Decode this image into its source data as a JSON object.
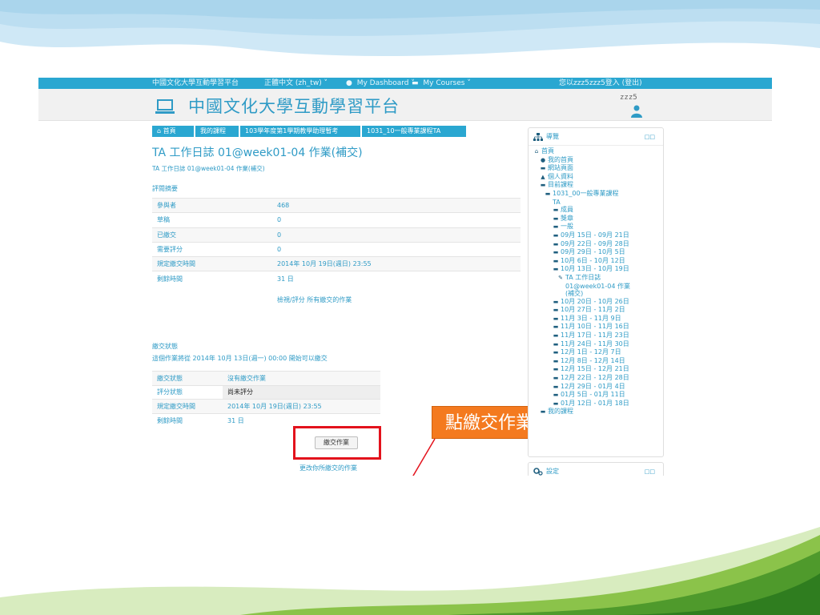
{
  "navbar": {
    "site": "中國文化大學互動學習平台",
    "language": "正體中文 (zh_tw) ˅",
    "dashboard": "My Dashboard ˅",
    "courses": "My Courses ˅",
    "login_status": "您以zzz5zzz5登入 (登出)"
  },
  "header": {
    "title": "中國文化大學互動學習平台",
    "user": "zzz5"
  },
  "breadcrumb": [
    "首頁",
    "我的課程",
    "103學年度第1學期教學助理暫考",
    "1031_10一般專業課程TA"
  ],
  "assignment": {
    "title": "TA 工作日誌 01@week01-04 作業(補交)",
    "description_link": "TA 工作日誌 01@week01-04 作業(補交)",
    "grading_summary_heading": "評閱摘要",
    "summary_rows": [
      {
        "label": "參與者",
        "value": "468"
      },
      {
        "label": "草稿",
        "value": "0"
      },
      {
        "label": "已繳交",
        "value": "0"
      },
      {
        "label": "需要評分",
        "value": "0"
      },
      {
        "label": "規定繳交時間",
        "value": "2014年 10月 19日(週日) 23:55"
      },
      {
        "label": "剩餘時間",
        "value": "31 日"
      }
    ],
    "view_grade_link": "檢視/評分 所有繳交的作業",
    "submission_status_heading": "繳交狀態",
    "submission_note": "這個作業將從 2014年 10月 13日(週一) 00:00 開始可以繳交",
    "status_rows": [
      {
        "label": "繳交狀態",
        "value": "沒有繳交作業"
      },
      {
        "label": "評分狀態",
        "value": "尚未評分"
      },
      {
        "label": "規定繳交時間",
        "value": "2014年 10月 19日(週日) 23:55"
      },
      {
        "label": "剩餘時間",
        "value": "31 日"
      }
    ],
    "submit_button": "繳交作業",
    "change_link": "更改你所繳交的作業"
  },
  "callout": {
    "text": "點繳交作業",
    "color": "#f47a1f",
    "highlight_color": "#e3121c"
  },
  "nav_block": {
    "title": "導覽",
    "controls": "□□",
    "items": [
      {
        "icon": "house-icon",
        "text": "首頁",
        "level": 0
      },
      {
        "icon": "dot-icon",
        "text": "我的首頁",
        "level": 1
      },
      {
        "icon": "folder-icon",
        "text": "網站頁面",
        "level": 1
      },
      {
        "icon": "person-icon",
        "text": "個人資料",
        "level": 1
      },
      {
        "icon": "folder-icon",
        "text": "目前課程",
        "level": 1
      },
      {
        "icon": "folder-icon",
        "text": "1031_00一般專業課程",
        "level": 2
      },
      {
        "icon": "",
        "text": "TA",
        "level": 2
      },
      {
        "icon": "folder-icon",
        "text": "成員",
        "level": 3
      },
      {
        "icon": "folder-icon",
        "text": "獎章",
        "level": 3
      },
      {
        "icon": "folder-icon",
        "text": "一般",
        "level": 3
      },
      {
        "icon": "folder-icon",
        "text": "09月 15日 - 09月 21日",
        "level": 3
      },
      {
        "icon": "folder-icon",
        "text": "09月 22日 - 09月 28日",
        "level": 3
      },
      {
        "icon": "folder-icon",
        "text": "09月 29日 - 10月 5日",
        "level": 3
      },
      {
        "icon": "folder-icon",
        "text": "10月 6日 - 10月 12日",
        "level": 3
      },
      {
        "icon": "folder-icon",
        "text": "10月 13日 - 10月 19日",
        "level": 3
      },
      {
        "icon": "assignment-icon",
        "text": "TA 工作日誌",
        "level": 4
      },
      {
        "icon": "",
        "text": "01@week01-04 作業",
        "level": 4
      },
      {
        "icon": "",
        "text": "(補交)",
        "level": 4
      },
      {
        "icon": "folder-icon",
        "text": "10月 20日 - 10月 26日",
        "level": 3
      },
      {
        "icon": "folder-icon",
        "text": "10月 27日 - 11月 2日",
        "level": 3
      },
      {
        "icon": "folder-icon",
        "text": "11月 3日 - 11月 9日",
        "level": 3
      },
      {
        "icon": "folder-icon",
        "text": "11月 10日 - 11月 16日",
        "level": 3
      },
      {
        "icon": "folder-icon",
        "text": "11月 17日 - 11月 23日",
        "level": 3
      },
      {
        "icon": "folder-icon",
        "text": "11月 24日 - 11月 30日",
        "level": 3
      },
      {
        "icon": "folder-icon",
        "text": "12月 1日 - 12月 7日",
        "level": 3
      },
      {
        "icon": "folder-icon",
        "text": "12月 8日 - 12月 14日",
        "level": 3
      },
      {
        "icon": "folder-icon",
        "text": "12月 15日 - 12月 21日",
        "level": 3
      },
      {
        "icon": "folder-icon",
        "text": "12月 22日 - 12月 28日",
        "level": 3
      },
      {
        "icon": "folder-icon",
        "text": "12月 29日 - 01月 4日",
        "level": 3
      },
      {
        "icon": "folder-icon",
        "text": "01月 5日 - 01月 11日",
        "level": 3
      },
      {
        "icon": "folder-icon",
        "text": "01月 12日 - 01月 18日",
        "level": 3
      },
      {
        "icon": "folder-icon",
        "text": "我的課程",
        "level": 1
      }
    ]
  },
  "settings_block": {
    "title": "設定",
    "controls": "□□"
  }
}
